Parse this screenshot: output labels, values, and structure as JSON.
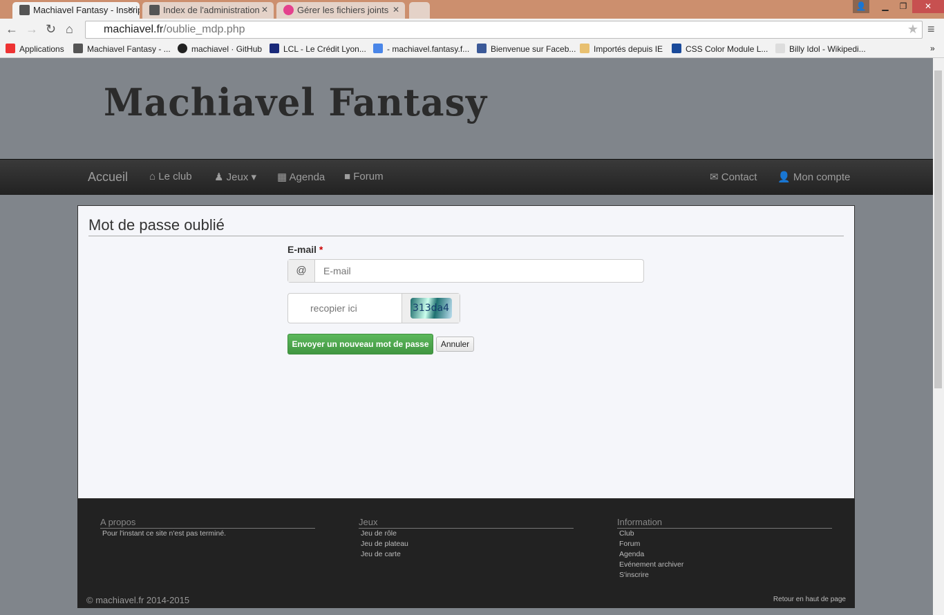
{
  "browser": {
    "tabs": [
      {
        "label": "Machiavel Fantasy - Inscrip",
        "active": true
      },
      {
        "label": "Index de l'administration"
      },
      {
        "label": "Gérer les fichiers joints"
      }
    ],
    "url_host": "machiavel.fr",
    "url_path": "/oublie_mdp.php",
    "bookmarks": [
      {
        "label": "Applications",
        "icon": "apps-icon",
        "color": "#e33"
      },
      {
        "label": "Machiavel Fantasy - ...",
        "icon": "site-icon",
        "color": "#555"
      },
      {
        "label": "machiavel · GitHub",
        "icon": "github-icon",
        "color": "#222"
      },
      {
        "label": "LCL - Le Crédit Lyon...",
        "icon": "lcl-icon",
        "color": "#1a2a7a"
      },
      {
        "label": "- machiavel.fantasy.f...",
        "icon": "google-icon",
        "color": "#4a86e8"
      },
      {
        "label": "Bienvenue sur Faceb...",
        "icon": "facebook-icon",
        "color": "#3b5998"
      },
      {
        "label": "Importés depuis IE",
        "icon": "folder-icon",
        "color": "#e8c070"
      },
      {
        "label": "CSS Color Module L...",
        "icon": "w3c-icon",
        "color": "#1a4a9a"
      },
      {
        "label": "Billy Idol - Wikipedi...",
        "icon": "wikipedia-icon",
        "color": "#ddd"
      }
    ]
  },
  "site": {
    "logo": "Machiavel Fantasy",
    "nav": {
      "home": "Accueil",
      "club": "Le club",
      "games": "Jeux",
      "agenda": "Agenda",
      "forum": "Forum",
      "contact": "Contact",
      "account": "Mon compte"
    },
    "form": {
      "title": "Mot de passe oublié",
      "email_label": "E-mail",
      "required": "*",
      "at": "@",
      "email_placeholder": "E-mail",
      "captcha_placeholder": "recopier ici",
      "captcha_text": "313da4",
      "submit": "Envoyer un nouveau mot de passe",
      "cancel": "Annuler"
    },
    "footer": {
      "about_title": "A propos",
      "about_text": "Pour l'instant ce site n'est pas terminé.",
      "games_title": "Jeux",
      "games": [
        "Jeu de rôle",
        "Jeu de plateau",
        "Jeu de carte"
      ],
      "info_title": "Information",
      "info": [
        "Club",
        "Forum",
        "Agenda",
        "Evénement archiver",
        "S'inscrire"
      ],
      "copyright": "© machiavel.fr 2014-2015",
      "back_top": "Retour en haut de page"
    }
  }
}
